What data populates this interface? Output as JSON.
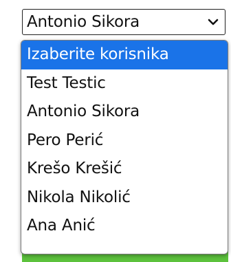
{
  "select": {
    "selected_value": "Antonio Sikora",
    "options": [
      "Izaberite korisnika",
      "Test Testic",
      "Antonio Sikora",
      "Pero Perić",
      "Krešo Krešić",
      "Nikola Nikolić",
      "Ana Anić"
    ],
    "highlighted_option": "Izaberite korisnika"
  },
  "colors": {
    "highlight": "#1a73e8",
    "panel_green": "#5cc23c"
  }
}
